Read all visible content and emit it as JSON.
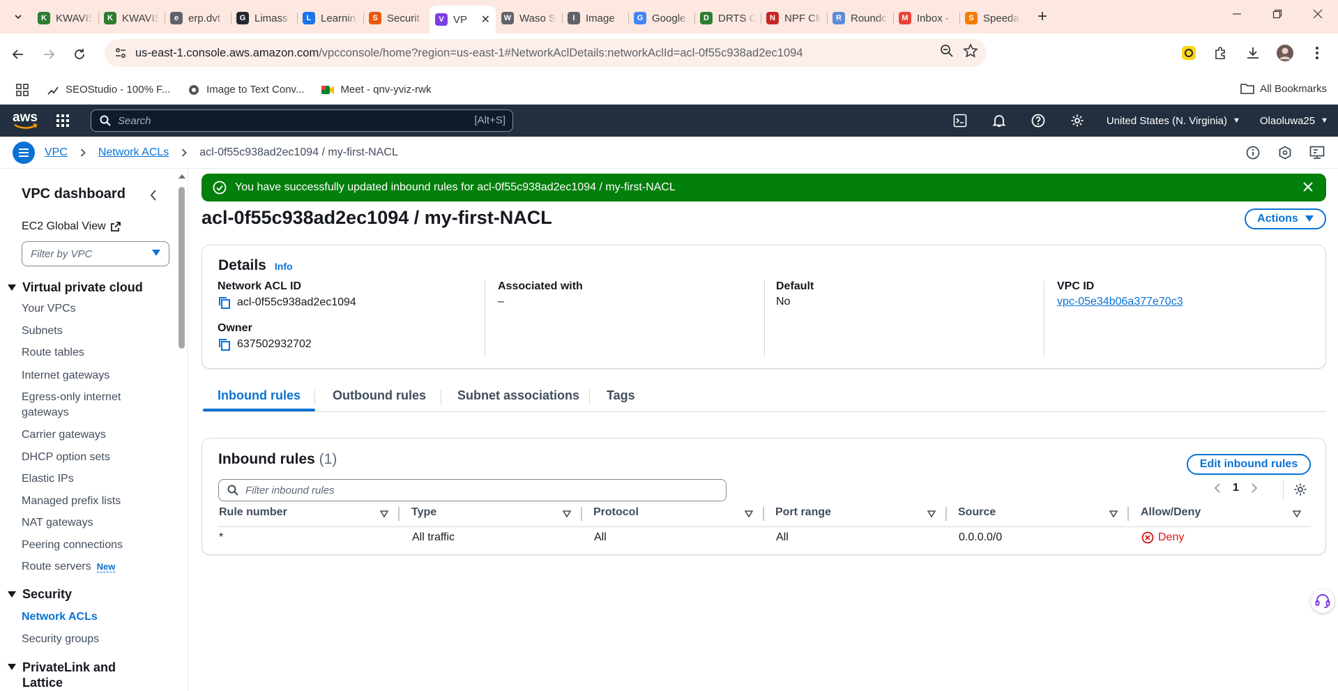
{
  "browser": {
    "tabs": [
      {
        "title": "KWAVIS",
        "color": "#2e7d32",
        "letter": "K"
      },
      {
        "title": "KWAVIS",
        "color": "#2e7d32",
        "letter": "K"
      },
      {
        "title": "erp.dvt",
        "color": "#5f6368",
        "letter": "e"
      },
      {
        "title": "Limass",
        "color": "#24292f",
        "letter": "G"
      },
      {
        "title": "Learnin",
        "color": "#1a73e8",
        "letter": "L"
      },
      {
        "title": "Securit",
        "color": "#e8590c",
        "letter": "S"
      },
      {
        "title": "VP",
        "color": "#7b3fe4",
        "letter": "V",
        "active": true
      },
      {
        "title": "Waso S",
        "color": "#5f6368",
        "letter": "W"
      },
      {
        "title": "Image",
        "color": "#5f6368",
        "letter": "I"
      },
      {
        "title": "Google",
        "color": "#4285f4",
        "letter": "G"
      },
      {
        "title": "DRTS C",
        "color": "#2e7d32",
        "letter": "D"
      },
      {
        "title": "NPF CM",
        "color": "#c62828",
        "letter": "N"
      },
      {
        "title": "Roundc",
        "color": "#5c8bd6",
        "letter": "R"
      },
      {
        "title": "Inbox -",
        "color": "#ea4335",
        "letter": "M"
      },
      {
        "title": "Speeda",
        "color": "#f57c00",
        "letter": "S"
      }
    ],
    "url_host": "us-east-1.console.aws.amazon.com",
    "url_path": "/vpcconsole/home?region=us-east-1#NetworkAclDetails:networkAclId=acl-0f55c938ad2ec1094",
    "bookmarks": [
      "SEOStudio - 100% F...",
      "Image to Text Conv...",
      "Meet - qnv-yviz-rwk"
    ],
    "all_bookmarks": "All Bookmarks"
  },
  "aws": {
    "logo": "aws",
    "search_placeholder": "Search",
    "search_shortcut": "[Alt+S]",
    "region": "United States (N. Virginia)",
    "user": "Olaoluwa25"
  },
  "breadcrumb": {
    "items": [
      "VPC",
      "Network ACLs"
    ],
    "current": "acl-0f55c938ad2ec1094 / my-first-NACL"
  },
  "sidebar": {
    "title": "VPC dashboard",
    "ec2_global": "EC2 Global View",
    "filter_placeholder": "Filter by VPC",
    "section_vpc": "Virtual private cloud",
    "vpc_items": [
      "Your VPCs",
      "Subnets",
      "Route tables",
      "Internet gateways",
      "Egress-only internet gateways",
      "Carrier gateways",
      "DHCP option sets",
      "Elastic IPs",
      "Managed prefix lists",
      "NAT gateways",
      "Peering connections",
      "Route servers"
    ],
    "new_badge": "New",
    "section_security": "Security",
    "security_items": [
      "Network ACLs",
      "Security groups"
    ],
    "section_privatelink": "PrivateLink and Lattice"
  },
  "flash": {
    "message": "You have successfully updated inbound rules for acl-0f55c938ad2ec1094 / my-first-NACL",
    "color": "#037f0c"
  },
  "page": {
    "title": "acl-0f55c938ad2ec1094 / my-first-NACL",
    "actions": "Actions"
  },
  "details": {
    "heading": "Details",
    "info": "Info",
    "acl_id_label": "Network ACL ID",
    "acl_id": "acl-0f55c938ad2ec1094",
    "owner_label": "Owner",
    "owner": "637502932702",
    "assoc_label": "Associated with",
    "assoc": "–",
    "default_label": "Default",
    "default": "No",
    "vpc_label": "VPC ID",
    "vpc": "vpc-05e34b06a377e70c3"
  },
  "tabs": [
    "Inbound rules",
    "Outbound rules",
    "Subnet associations",
    "Tags"
  ],
  "rules": {
    "heading": "Inbound rules",
    "count": "(1)",
    "edit": "Edit inbound rules",
    "filter_placeholder": "Filter inbound rules",
    "page": "1",
    "columns": [
      "Rule number",
      "Type",
      "Protocol",
      "Port range",
      "Source",
      "Allow/Deny"
    ],
    "rows": [
      {
        "rule": "*",
        "type": "All traffic",
        "protocol": "All",
        "port": "All",
        "source": "0.0.0.0/0",
        "action": "Deny"
      }
    ],
    "deny_color": "#d91515"
  },
  "accent": "#0972d3"
}
